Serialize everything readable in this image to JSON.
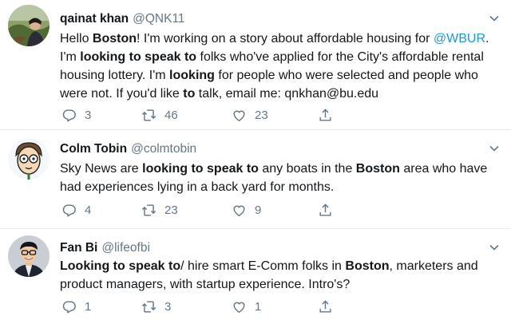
{
  "tweets": [
    {
      "name": "qainat khan",
      "handle": "@QNK11",
      "body_segments": [
        {
          "t": "Hello "
        },
        {
          "t": "Boston",
          "b": true
        },
        {
          "t": "! I'm working on a story about affordable housing for "
        },
        {
          "t": "@WBUR",
          "link": true
        },
        {
          "t": ". I'm "
        },
        {
          "t": "looking to speak to",
          "b": true
        },
        {
          "t": " folks who've applied for the City's affordable rental housing lottery. I'm "
        },
        {
          "t": "looking",
          "b": true
        },
        {
          "t": " for people who were selected and people who were not. If you'd like "
        },
        {
          "t": "to",
          "b": true
        },
        {
          "t": " talk, email me: qnkhan@bu.edu"
        }
      ],
      "replies": "3",
      "retweets": "46",
      "likes": "23"
    },
    {
      "name": "Colm Tobin",
      "handle": "@colmtobin",
      "body_segments": [
        {
          "t": "Sky News are "
        },
        {
          "t": "looking to speak to",
          "b": true
        },
        {
          "t": " any boats in the "
        },
        {
          "t": "Boston",
          "b": true
        },
        {
          "t": " area who have had experiences lying in a back yard for months."
        }
      ],
      "replies": "4",
      "retweets": "23",
      "likes": "9"
    },
    {
      "name": "Fan Bi",
      "handle": "@lifeofbi",
      "body_segments": [
        {
          "t": "Looking to speak to",
          "b": true
        },
        {
          "t": "/ hire smart E-Comm folks in "
        },
        {
          "t": "Boston",
          "b": true
        },
        {
          "t": ", marketers and product managers, with startup experience. Intro's?"
        }
      ],
      "replies": "1",
      "retweets": "3",
      "likes": "1"
    }
  ],
  "icons": {
    "reply": "reply-icon",
    "retweet": "retweet-icon",
    "like": "heart-icon",
    "share": "share-icon",
    "menu": "chevron-down-icon"
  },
  "colors": {
    "text": "#14171a",
    "secondary": "#657786",
    "link": "#1b95e0",
    "divider": "#e6ecf0"
  }
}
